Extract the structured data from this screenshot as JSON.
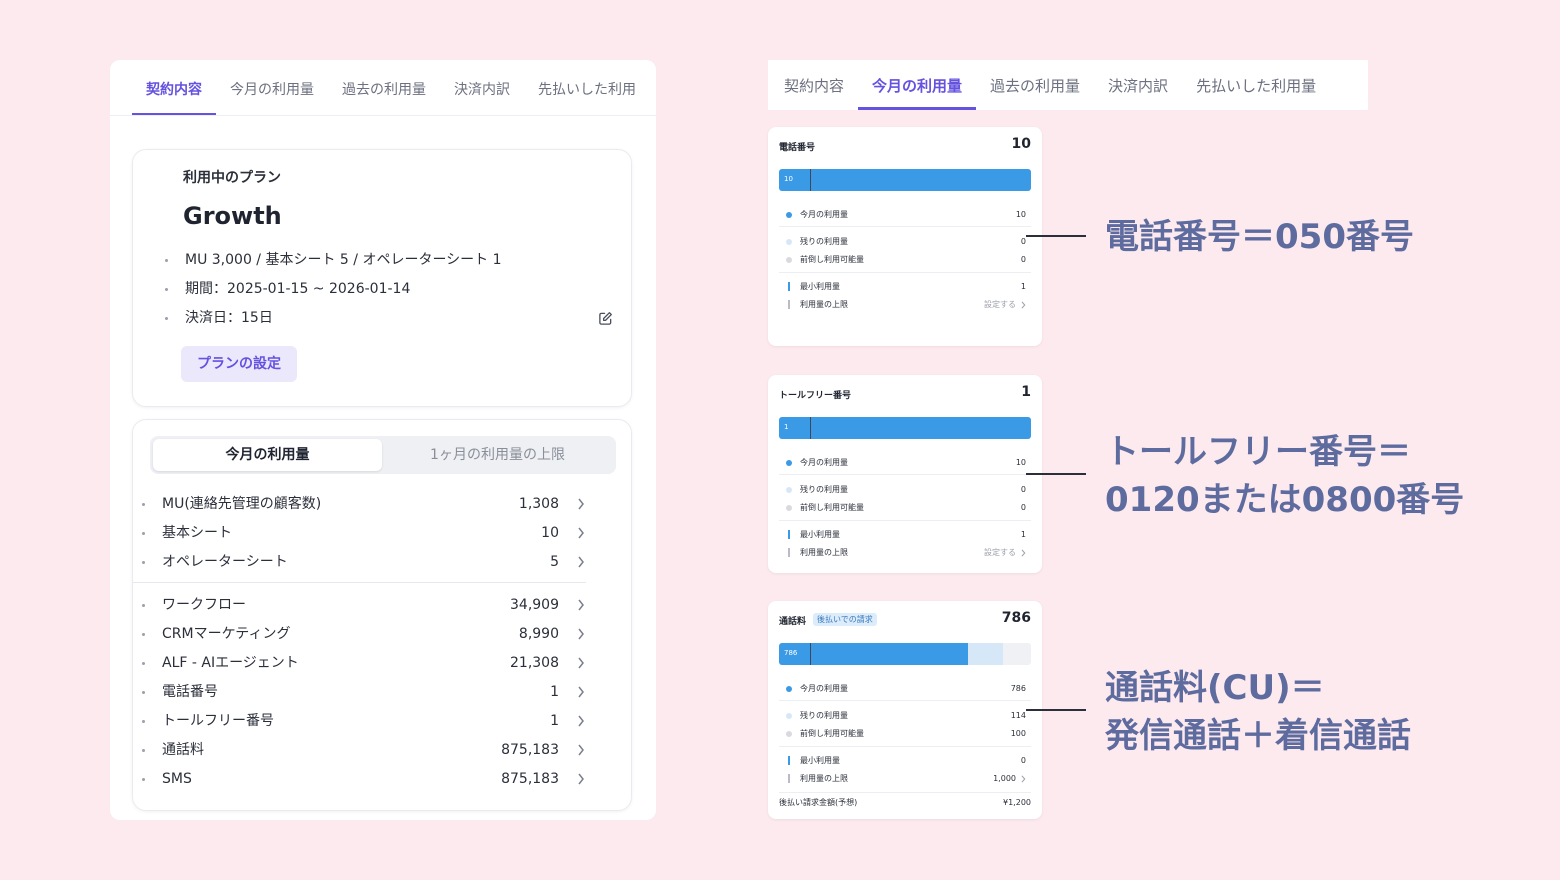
{
  "left_panel": {
    "tabs": [
      "契約内容",
      "今月の利用量",
      "過去の利用量",
      "決済内訳",
      "先払いした利用"
    ],
    "plan": {
      "subtitle": "利用中のプラン",
      "name": "Growth",
      "details": [
        "MU 3,000 / 基本シート 5 / オペレーターシート 1",
        "期間：2025-01-15 ~ 2026-01-14",
        "決済日：15日"
      ],
      "button": "プランの設定"
    },
    "usage": {
      "segment_active": "今月の利用量",
      "segment_inactive": "1ヶ月の利用量の上限",
      "rows": [
        {
          "label": "MU(連絡先管理の顧客数)",
          "value": "1,308"
        },
        {
          "label": "基本シート",
          "value": "10"
        },
        {
          "label": "オペレーターシート",
          "value": "5"
        },
        {
          "label": "ワークフロー",
          "value": "34,909"
        },
        {
          "label": "CRMマーケティング",
          "value": "8,990"
        },
        {
          "label": "ALF - AIエージェント",
          "value": "21,308"
        },
        {
          "label": "電話番号",
          "value": "1"
        },
        {
          "label": "トールフリー番号",
          "value": "1"
        },
        {
          "label": "通話料",
          "value": "875,183"
        },
        {
          "label": "SMS",
          "value": "875,183"
        }
      ]
    }
  },
  "right_panel": {
    "tabs": [
      "契約内容",
      "今月の利用量",
      "過去の利用量",
      "決済内訳",
      "先払いした利用量"
    ],
    "cards": [
      {
        "title": "電話番号",
        "total": "10",
        "bar_label": "10",
        "fill_fraction": 1.0,
        "rows": [
          {
            "label": "今月の利用量",
            "value": "10"
          },
          {
            "label": "残りの利用量",
            "value": "0"
          },
          {
            "label": "前倒し利用可能量",
            "value": "0"
          },
          {
            "label": "最小利用量",
            "value": "1"
          },
          {
            "label": "利用量の上限",
            "value": "設定する"
          }
        ]
      },
      {
        "title": "トールフリー番号",
        "total": "1",
        "bar_label": "1",
        "fill_fraction": 1.0,
        "rows": [
          {
            "label": "今月の利用量",
            "value": "10"
          },
          {
            "label": "残りの利用量",
            "value": "0"
          },
          {
            "label": "前倒し利用可能量",
            "value": "0"
          },
          {
            "label": "最小利用量",
            "value": "1"
          },
          {
            "label": "利用量の上限",
            "value": "設定する"
          }
        ]
      },
      {
        "title": "通話料",
        "badge": "後払いでの請求",
        "total": "786",
        "bar_label": "786",
        "fill_fraction": 0.75,
        "remaining_fraction": 0.14,
        "rows": [
          {
            "label": "今月の利用量",
            "value": "786"
          },
          {
            "label": "残りの利用量",
            "value": "114"
          },
          {
            "label": "前倒し利用可能量",
            "value": "100"
          },
          {
            "label": "最小利用量",
            "value": "0"
          },
          {
            "label": "利用量の上限",
            "value": "1,000"
          }
        ],
        "footer_label": "後払い請求金額(予想)",
        "footer_value": "¥1,200"
      }
    ]
  },
  "annotations": {
    "phone": "電話番号＝050番号",
    "tollfree_line1": "トールフリー番号＝",
    "tollfree_line2": "0120または0800番号",
    "callfee_line1": "通話料(CU)＝",
    "callfee_line2": "発信通話＋着信通話"
  },
  "colors": {
    "accent": "#6452e0",
    "bar_fill": "#3a9ae6",
    "bar_remaining": "#d6e8f8",
    "annotation": "#5d6b9f",
    "background": "#fdeaee"
  }
}
